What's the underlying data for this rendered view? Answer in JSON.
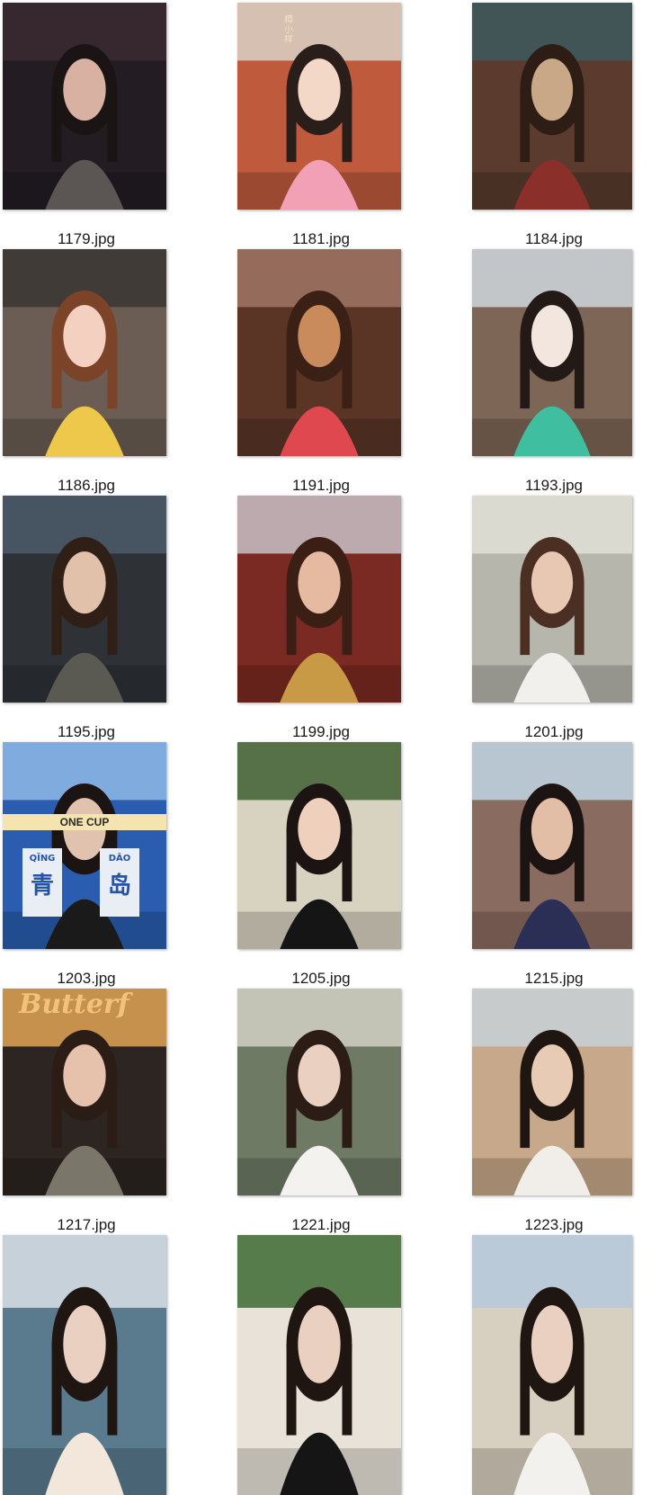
{
  "files": [
    {
      "name": "1179.jpg",
      "icon": "photo-thumbnail",
      "colors": {
        "bg": "#231d23",
        "top": "#3a2a30",
        "skin": "#d9b1a3",
        "hair": "#1a1414",
        "cloth": "#5b5654"
      }
    },
    {
      "name": "1181.jpg",
      "icon": "photo-thumbnail",
      "colors": {
        "bg": "#bf5a3d",
        "top": "#d8d2c6",
        "skin": "#f3d7c7",
        "hair": "#2a1e1b",
        "cloth": "#f2a0b5"
      }
    },
    {
      "name": "1184.jpg",
      "icon": "photo-thumbnail",
      "colors": {
        "bg": "#5a3b2d",
        "top": "#3d5a5f",
        "skin": "#c9a887",
        "hair": "#2d1d15",
        "cloth": "#8b2f2a"
      }
    },
    {
      "name": "1186.jpg",
      "icon": "photo-thumbnail",
      "colors": {
        "bg": "#6b5d53",
        "top": "#3a3532",
        "skin": "#f4d0c1",
        "hair": "#7b4428",
        "cloth": "#eec84a"
      }
    },
    {
      "name": "1191.jpg",
      "icon": "photo-thumbnail",
      "colors": {
        "bg": "#5a3526",
        "top": "#a07466",
        "skin": "#c98a5c",
        "hair": "#3b2016",
        "cloth": "#e0484f"
      }
    },
    {
      "name": "1193.jpg",
      "icon": "photo-thumbnail",
      "colors": {
        "bg": "#7d6656",
        "top": "#cfd7dc",
        "skin": "#f3e6df",
        "hair": "#231a17",
        "cloth": "#3fbfa0"
      }
    },
    {
      "name": "1195.jpg",
      "icon": "photo-thumbnail",
      "colors": {
        "bg": "#2e3136",
        "top": "#4b5a6a",
        "skin": "#e2c1ab",
        "hair": "#2f1f17",
        "cloth": "#5b5a52"
      }
    },
    {
      "name": "1199.jpg",
      "icon": "photo-thumbnail",
      "colors": {
        "bg": "#7a2a22",
        "top": "#c9c1c7",
        "skin": "#e6b9a1",
        "hair": "#3b1e14",
        "cloth": "#c99a45"
      }
    },
    {
      "name": "1201.jpg",
      "icon": "photo-thumbnail",
      "colors": {
        "bg": "#b7b6ad",
        "top": "#e2e0d6",
        "skin": "#e8c7b3",
        "hair": "#4a2f22",
        "cloth": "#f1f0ec"
      }
    },
    {
      "name": "1203.jpg",
      "icon": "photo-thumbnail",
      "colors": {
        "bg": "#2a5db0",
        "top": "#8fb8e6",
        "skin": "#e1c2ae",
        "hair": "#1c1412",
        "cloth": "#1a1a1a"
      }
    },
    {
      "name": "1205.jpg",
      "icon": "photo-thumbnail",
      "colors": {
        "bg": "#d8d2c1",
        "top": "#3f5f32",
        "skin": "#efd0bc",
        "hair": "#1c1412",
        "cloth": "#151515"
      }
    },
    {
      "name": "1215.jpg",
      "icon": "photo-thumbnail",
      "colors": {
        "bg": "#8a6b5f",
        "top": "#bfd6e6",
        "skin": "#e2bea6",
        "hair": "#1c1412",
        "cloth": "#2b2f55"
      }
    },
    {
      "name": "1217.jpg",
      "icon": "photo-thumbnail",
      "colors": {
        "bg": "#2d2521",
        "top": "#e1a554",
        "skin": "#e6c2ad",
        "hair": "#2c1c16",
        "cloth": "#7a766a"
      }
    },
    {
      "name": "1221.jpg",
      "icon": "photo-thumbnail",
      "colors": {
        "bg": "#6e7a64",
        "top": "#d3d1c4",
        "skin": "#ead0c0",
        "hair": "#2b1c15",
        "cloth": "#f3f2ee"
      }
    },
    {
      "name": "1223.jpg",
      "icon": "photo-thumbnail",
      "colors": {
        "bg": "#c8a88a",
        "top": "#c7d1d6",
        "skin": "#e8cbb5",
        "hair": "#1f1612",
        "cloth": "#f1eee9"
      }
    },
    {
      "name": "",
      "icon": "photo-thumbnail",
      "colors": {
        "bg": "#5a7a8e",
        "top": "#d9e0e6",
        "skin": "#ead0c0",
        "hair": "#1f1612",
        "cloth": "#f2e7da"
      }
    },
    {
      "name": "",
      "icon": "photo-thumbnail",
      "colors": {
        "bg": "#e8e2d8",
        "top": "#3d6a34",
        "skin": "#ead0c0",
        "hair": "#1f1612",
        "cloth": "#151515"
      }
    },
    {
      "name": "",
      "icon": "photo-thumbnail",
      "colors": {
        "bg": "#d7cfbf",
        "top": "#b5c9dd",
        "skin": "#ead0c0",
        "hair": "#1f1612",
        "cloth": "#f3f1ee"
      }
    }
  ],
  "overlays": {
    "1181": "樽小样",
    "1203": {
      "brand": "ONE CUP",
      "left_pinyin": "QĪNG",
      "left_char": "青",
      "right_pinyin": "DǍO",
      "right_char": "岛"
    },
    "1217": "Butterf"
  }
}
